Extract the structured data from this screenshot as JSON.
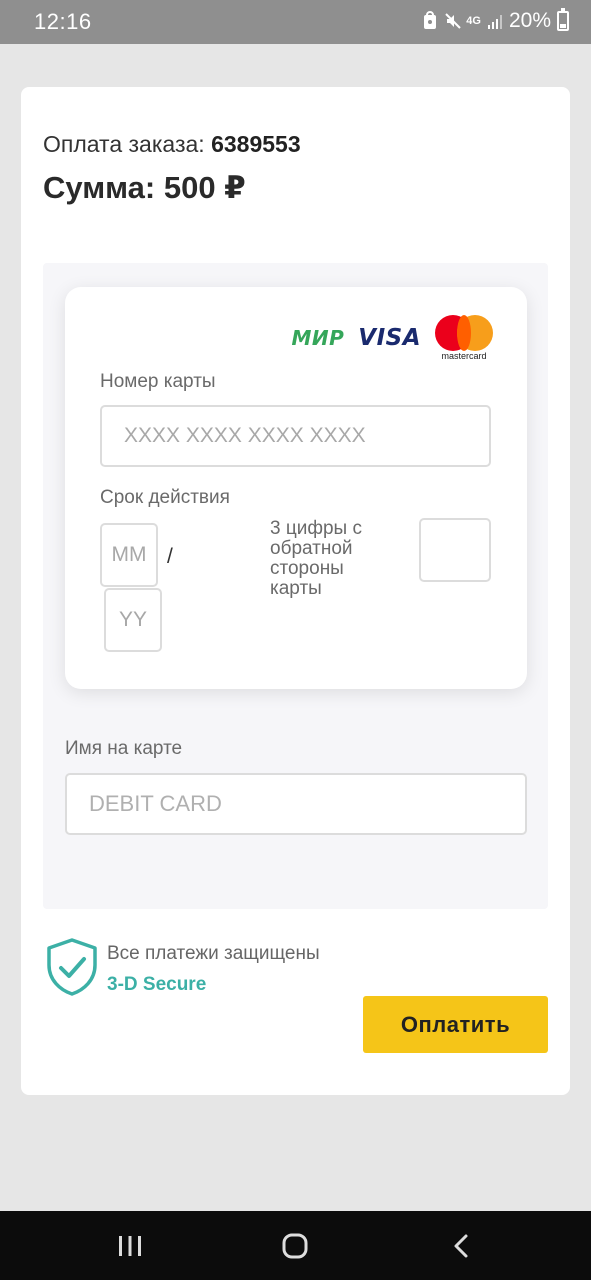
{
  "status_bar": {
    "time": "12:16",
    "network": "4G",
    "battery": "20%"
  },
  "order": {
    "label": "Оплата заказа:",
    "number": "6389553",
    "sum": "Сумма: 500 ₽"
  },
  "card_logos": {
    "mir": "МИР",
    "visa": "VISA",
    "mastercard": "mastercard"
  },
  "card_form": {
    "number_label": "Номер карты",
    "number_placeholder": "XXXX XXXX XXXX XXXX",
    "expiry_label": "Срок действия",
    "month_placeholder": "MM",
    "year_placeholder": "YY",
    "separator": "/",
    "cvc_label": "3 цифры с обратной стороны карты",
    "cvc_value": ""
  },
  "name_field": {
    "label": "Имя на карте",
    "placeholder": "DEBIT CARD"
  },
  "security": {
    "text": "Все платежи защищены",
    "badge": "3-D Secure"
  },
  "pay_button": {
    "label": "Оплатить"
  },
  "colors": {
    "accent_button": "#f5c518",
    "secure_green": "#3cb0a6",
    "mir_green": "#35a65a",
    "visa_blue": "#1a2a6e"
  }
}
